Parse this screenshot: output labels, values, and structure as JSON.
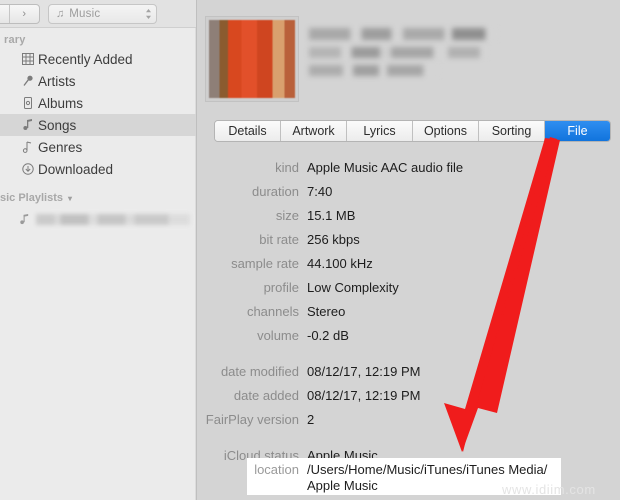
{
  "toolbar": {
    "nav_back_icon": "chevron-left-icon",
    "nav_forward_label": "›",
    "source_icon": "music-note-icon",
    "source_label": "Music",
    "source_chevron": "⌃⌄"
  },
  "sidebar": {
    "library_header": "rary",
    "items": [
      {
        "label": "Recently Added",
        "icon": "grid-icon",
        "selected": false
      },
      {
        "label": "Artists",
        "icon": "microphone-icon",
        "selected": false
      },
      {
        "label": "Albums",
        "icon": "album-icon",
        "selected": false
      },
      {
        "label": "Songs",
        "icon": "music-note-icon",
        "selected": true
      },
      {
        "label": "Genres",
        "icon": "genre-icon",
        "selected": false
      },
      {
        "label": "Downloaded",
        "icon": "download-circle-icon",
        "selected": false
      }
    ],
    "section_label": "sic Playlists",
    "section_chevron": "⌄",
    "playlist_item_icon": "music-note-icon"
  },
  "panel": {
    "artwork_name": "album-artwork",
    "tabs": [
      {
        "label": "Details",
        "active": false
      },
      {
        "label": "Artwork",
        "active": false
      },
      {
        "label": "Lyrics",
        "active": false
      },
      {
        "label": "Options",
        "active": false
      },
      {
        "label": "Sorting",
        "active": false
      },
      {
        "label": "File",
        "active": true
      }
    ],
    "fields": [
      {
        "label": "kind",
        "value": "Apple Music AAC audio file"
      },
      {
        "label": "duration",
        "value": "7:40"
      },
      {
        "label": "size",
        "value": "15.1 MB"
      },
      {
        "label": "bit rate",
        "value": "256 kbps"
      },
      {
        "label": "sample rate",
        "value": "44.100 kHz"
      },
      {
        "label": "profile",
        "value": "Low Complexity"
      },
      {
        "label": "channels",
        "value": "Stereo"
      },
      {
        "label": "volume",
        "value": "-0.2 dB"
      }
    ],
    "fields2": [
      {
        "label": "date modified",
        "value": "08/12/17, 12:19 PM"
      },
      {
        "label": "date added",
        "value": "08/12/17, 12:19 PM"
      },
      {
        "label": "FairPlay version",
        "value": "2"
      }
    ],
    "fields3": [
      {
        "label": "iCloud status",
        "value": "Apple Music"
      }
    ],
    "location": {
      "label": "location",
      "line1": "/Users/Home/Music/iTunes/iTunes Media/",
      "line2": "Apple Music"
    }
  },
  "annotation": {
    "arrow_color": "#f01c1c",
    "arrow_name": "red-pointer-arrow"
  },
  "watermark": {
    "text": "www.idiim.com"
  },
  "colors": {
    "accent_blue": "#1174dd",
    "panel_bg": "#d4d4d4",
    "sidebar_bg": "#ebebeb",
    "selection_gray": "#d6d6d6"
  }
}
